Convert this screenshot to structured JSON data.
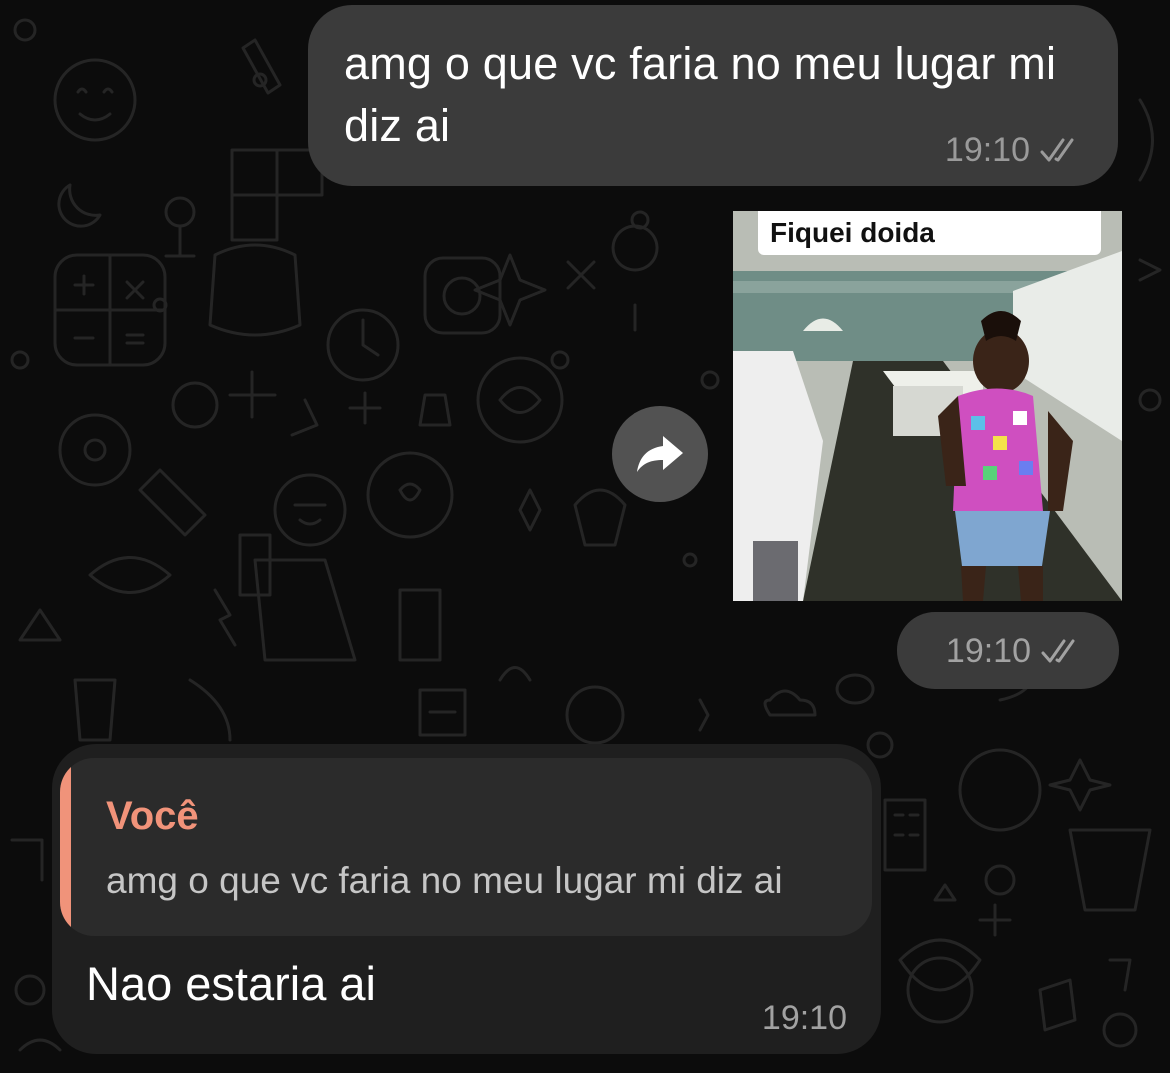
{
  "chat": {
    "messages": [
      {
        "direction": "outgoing",
        "text": "amg o que vc faria no meu lugar mi diz ai",
        "time": "19:10",
        "status_icon": "double-check-icon"
      },
      {
        "direction": "outgoing",
        "type": "video",
        "caption_overlay": "Fiquei doida",
        "time": "19:10",
        "status_icon": "double-check-icon",
        "action_icon": "forward-icon"
      },
      {
        "direction": "incoming",
        "reply_to": {
          "author": "Você",
          "text": "amg o que vc faria no meu lugar mi diz ai"
        },
        "text": "Nao estaria ai",
        "time": "19:10"
      }
    ]
  },
  "colors": {
    "background": "#0c0c0c",
    "outgoing_bubble": "#3b3b3b",
    "incoming_bubble": "#1f1f1f",
    "quote_accent": "#f0937a",
    "meta_text": "#9a9a9a"
  }
}
